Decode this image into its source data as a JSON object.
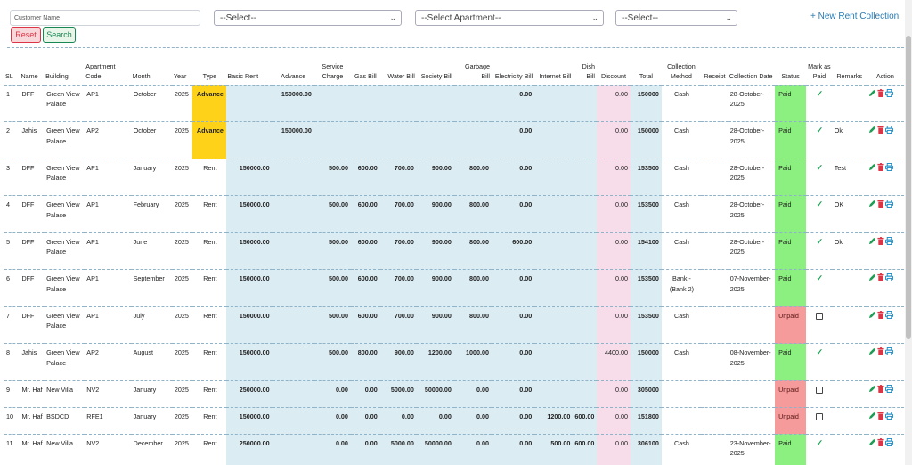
{
  "filters": {
    "customer_placeholder": "Customer Name",
    "select1": "--Select--",
    "select_apartment": "--Select Apartment--",
    "select3": "--Select--",
    "reset_label": "Reset",
    "search_label": "Search",
    "new_rent_collection": "+ New Rent Collection"
  },
  "table": {
    "headers": [
      "SL",
      "Name",
      "Building",
      "Apartment Code",
      "Month",
      "Year",
      "Type",
      "Basic Rent",
      "Advance",
      "Service Charge",
      "Gas Bill",
      "Water Bill",
      "Society Bill",
      "Garbage Bill",
      "Electricity Bill",
      "Internet Bill",
      "Dish Bill",
      "Discount",
      "Total",
      "Collection Method",
      "Receipt",
      "Collection Date",
      "Status",
      "Mark as Paid",
      "Remarks",
      "Action"
    ],
    "rows": [
      {
        "sl": "1",
        "name": "DFF",
        "building": "Green View Palace",
        "apt": "AP1",
        "month": "October",
        "year": "2025",
        "type": "Advance",
        "basic": "",
        "advance": "150000.00",
        "service": "",
        "gas": "",
        "water": "",
        "society": "",
        "garbage": "",
        "electricity": "0.00",
        "internet": "",
        "dish": "",
        "discount": "0.00",
        "total": "150000",
        "method": "Cash",
        "receipt": "",
        "date": "28-October-2025",
        "status": "Paid",
        "mark": "check",
        "remarks": ""
      },
      {
        "sl": "2",
        "name": "Jahis",
        "building": "Green View Palace",
        "apt": "AP2",
        "month": "October",
        "year": "2025",
        "type": "Advance",
        "basic": "",
        "advance": "150000.00",
        "service": "",
        "gas": "",
        "water": "",
        "society": "",
        "garbage": "",
        "electricity": "0.00",
        "internet": "",
        "dish": "",
        "discount": "0.00",
        "total": "150000",
        "method": "Cash",
        "receipt": "",
        "date": "28-October-2025",
        "status": "Paid",
        "mark": "check",
        "remarks": "Ok"
      },
      {
        "sl": "3",
        "name": "DFF",
        "building": "Green View Palace",
        "apt": "AP1",
        "month": "January",
        "year": "2025",
        "type": "Rent",
        "basic": "150000.00",
        "advance": "",
        "service": "500.00",
        "gas": "600.00",
        "water": "700.00",
        "society": "900.00",
        "garbage": "800.00",
        "electricity": "0.00",
        "internet": "",
        "dish": "",
        "discount": "0.00",
        "total": "153500",
        "method": "Cash",
        "receipt": "",
        "date": "28-October-2025",
        "status": "Paid",
        "mark": "check",
        "remarks": "Test"
      },
      {
        "sl": "4",
        "name": "DFF",
        "building": "Green View Palace",
        "apt": "AP1",
        "month": "February",
        "year": "2025",
        "type": "Rent",
        "basic": "150000.00",
        "advance": "",
        "service": "500.00",
        "gas": "600.00",
        "water": "700.00",
        "society": "900.00",
        "garbage": "800.00",
        "electricity": "0.00",
        "internet": "",
        "dish": "",
        "discount": "0.00",
        "total": "153500",
        "method": "Cash",
        "receipt": "",
        "date": "28-October-2025",
        "status": "Paid",
        "mark": "check",
        "remarks": "OK"
      },
      {
        "sl": "5",
        "name": "DFF",
        "building": "Green View Palace",
        "apt": "AP1",
        "month": "June",
        "year": "2025",
        "type": "Rent",
        "basic": "150000.00",
        "advance": "",
        "service": "500.00",
        "gas": "600.00",
        "water": "700.00",
        "society": "900.00",
        "garbage": "800.00",
        "electricity": "600.00",
        "internet": "",
        "dish": "",
        "discount": "0.00",
        "total": "154100",
        "method": "Cash",
        "receipt": "",
        "date": "28-October-2025",
        "status": "Paid",
        "mark": "check",
        "remarks": "Ok"
      },
      {
        "sl": "6",
        "name": "DFF",
        "building": "Green View Palace",
        "apt": "AP1",
        "month": "September",
        "year": "2025",
        "type": "Rent",
        "basic": "150000.00",
        "advance": "",
        "service": "500.00",
        "gas": "600.00",
        "water": "700.00",
        "society": "900.00",
        "garbage": "800.00",
        "electricity": "0.00",
        "internet": "",
        "dish": "",
        "discount": "0.00",
        "total": "153500",
        "method": "Bank - (Bank 2)",
        "receipt": "",
        "date": "07-November-2025",
        "status": "Paid",
        "mark": "check",
        "remarks": ""
      },
      {
        "sl": "7",
        "name": "DFF",
        "building": "Green View Palace",
        "apt": "AP1",
        "month": "July",
        "year": "2025",
        "type": "Rent",
        "basic": "150000.00",
        "advance": "",
        "service": "500.00",
        "gas": "600.00",
        "water": "700.00",
        "society": "900.00",
        "garbage": "800.00",
        "electricity": "0.00",
        "internet": "",
        "dish": "",
        "discount": "0.00",
        "total": "153500",
        "method": "Cash",
        "receipt": "",
        "date": "",
        "status": "Unpaid",
        "mark": "box",
        "remarks": ""
      },
      {
        "sl": "8",
        "name": "Jahis",
        "building": "Green View Palace",
        "apt": "AP2",
        "month": "August",
        "year": "2025",
        "type": "Rent",
        "basic": "150000.00",
        "advance": "",
        "service": "500.00",
        "gas": "800.00",
        "water": "900.00",
        "society": "1200.00",
        "garbage": "1000.00",
        "electricity": "0.00",
        "internet": "",
        "dish": "",
        "discount": "4400.00",
        "total": "150000",
        "method": "Cash",
        "receipt": "",
        "date": "08-November-2025",
        "status": "Paid",
        "mark": "check",
        "remarks": ""
      },
      {
        "sl": "9",
        "name": "Mr. Haf",
        "building": "New Villa",
        "apt": "NV2",
        "month": "January",
        "year": "2025",
        "type": "Rent",
        "basic": "250000.00",
        "advance": "",
        "service": "0.00",
        "gas": "0.00",
        "water": "5000.00",
        "society": "50000.00",
        "garbage": "0.00",
        "electricity": "0.00",
        "internet": "",
        "dish": "",
        "discount": "0.00",
        "total": "305000",
        "method": "",
        "receipt": "",
        "date": "",
        "status": "Unpaid",
        "mark": "box",
        "remarks": ""
      },
      {
        "sl": "10",
        "name": "Mr. Haf",
        "building": "BSDCD",
        "apt": "RFE1",
        "month": "January",
        "year": "2025",
        "type": "Rent",
        "basic": "150000.00",
        "advance": "",
        "service": "0.00",
        "gas": "0.00",
        "water": "0.00",
        "society": "0.00",
        "garbage": "0.00",
        "electricity": "0.00",
        "internet": "1200.00",
        "dish": "600.00",
        "discount": "0.00",
        "total": "151800",
        "method": "",
        "receipt": "",
        "date": "",
        "status": "Unpaid",
        "mark": "box",
        "remarks": ""
      },
      {
        "sl": "11",
        "name": "Mr. Haf",
        "building": "New Villa",
        "apt": "NV2",
        "month": "December",
        "year": "2025",
        "type": "Rent",
        "basic": "250000.00",
        "advance": "",
        "service": "0.00",
        "gas": "0.00",
        "water": "5000.00",
        "society": "50000.00",
        "garbage": "0.00",
        "electricity": "0.00",
        "internet": "500.00",
        "dish": "600.00",
        "discount": "0.00",
        "total": "306100",
        "method": "Cash",
        "receipt": "",
        "date": "23-November-2025",
        "status": "Paid",
        "mark": "check",
        "remarks": ""
      }
    ]
  },
  "icons": {
    "edit": "pencil-icon",
    "delete": "trash-icon",
    "print": "printer-icon",
    "mark": "check-icon"
  },
  "colors": {
    "advance": "#ffd21a",
    "paid": "#8bf07f",
    "unpaid": "#f59b9b",
    "amount_bg": "#dcecf3",
    "discount_bg": "#f6dde9",
    "accent": "#2a7ab0",
    "check": "#1f9d55",
    "edit": "#1f9d55",
    "delete": "#dc3545",
    "print": "#1c8fc9"
  }
}
